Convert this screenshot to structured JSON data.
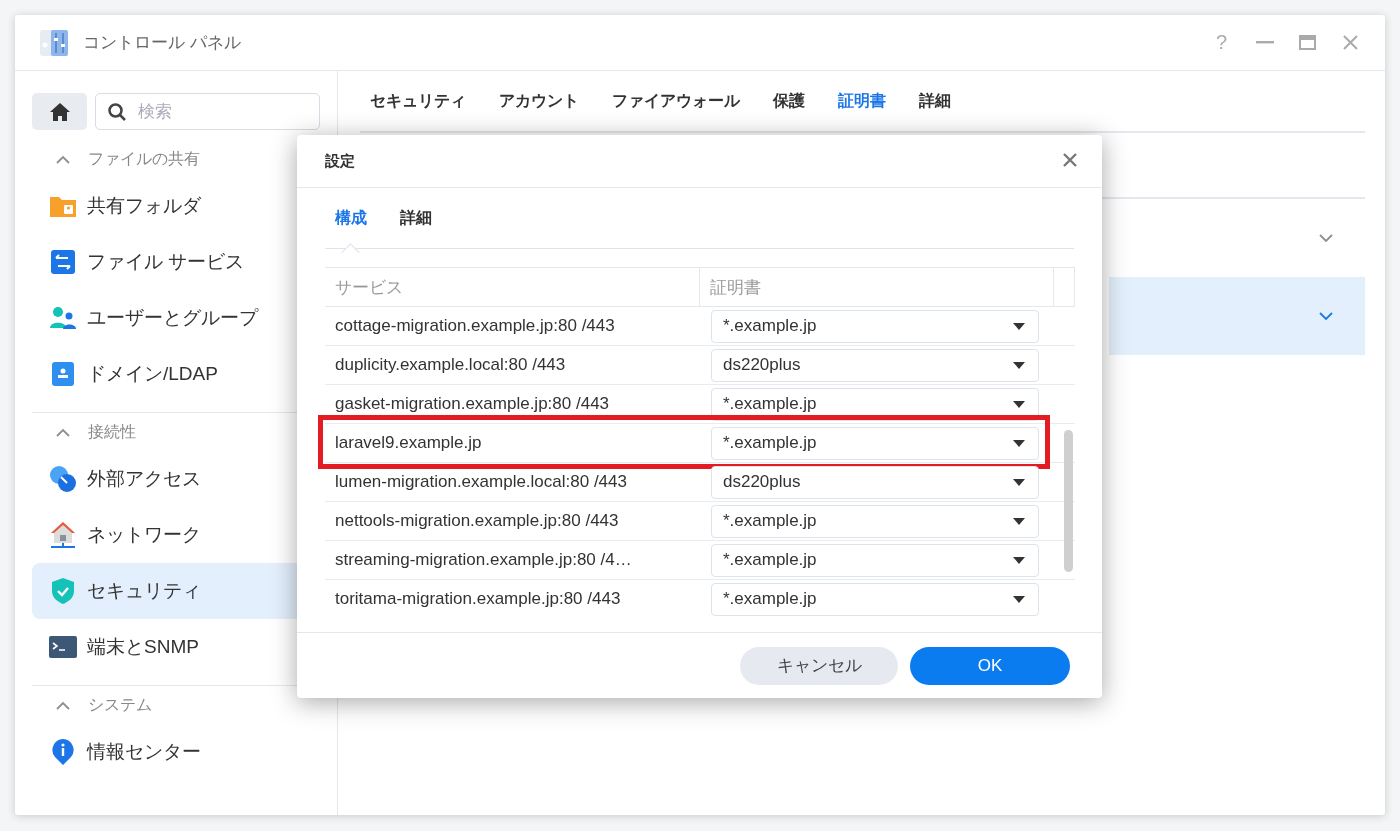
{
  "window": {
    "title": "コントロール パネル",
    "help_label": "?"
  },
  "sidebar": {
    "search": {
      "placeholder": "検索"
    },
    "sections": [
      {
        "title": "ファイルの共有",
        "expanded": true,
        "items": [
          {
            "label": "共有フォルダ",
            "selected": false
          },
          {
            "label": "ファイル サービス",
            "selected": false
          },
          {
            "label": "ユーザーとグループ",
            "selected": false
          },
          {
            "label": "ドメイン/LDAP",
            "selected": false
          }
        ]
      },
      {
        "title": "接続性",
        "expanded": true,
        "items": [
          {
            "label": "外部アクセス",
            "selected": false
          },
          {
            "label": "ネットワーク",
            "selected": false
          },
          {
            "label": "セキュリティ",
            "selected": true
          },
          {
            "label": "端末とSNMP",
            "selected": false
          }
        ]
      },
      {
        "title": "システム",
        "expanded": true,
        "items": [
          {
            "label": "情報センター",
            "selected": false
          }
        ]
      }
    ]
  },
  "main": {
    "tabs": [
      {
        "label": "セキュリティ",
        "selected": false
      },
      {
        "label": "アカウント",
        "selected": false
      },
      {
        "label": "ファイアウォール",
        "selected": false
      },
      {
        "label": "保護",
        "selected": false
      },
      {
        "label": "証明書",
        "selected": true
      },
      {
        "label": "詳細",
        "selected": false
      }
    ],
    "panels": [
      {
        "selected": false
      },
      {
        "selected": true
      }
    ]
  },
  "dialog": {
    "title": "設定",
    "tabs": [
      {
        "label": "構成",
        "selected": true
      },
      {
        "label": "詳細",
        "selected": false
      }
    ],
    "columns": [
      "サービス",
      "証明書"
    ],
    "rows": [
      {
        "service": "cottage-migration.example.jp:80 /443",
        "certificate": "*.example.jp",
        "highlighted": false
      },
      {
        "service": "duplicity.example.local:80 /443",
        "certificate": "ds220plus",
        "highlighted": false
      },
      {
        "service": "gasket-migration.example.jp:80 /443",
        "certificate": "*.example.jp",
        "highlighted": false
      },
      {
        "service": "laravel9.example.jp",
        "certificate": "*.example.jp",
        "highlighted": true
      },
      {
        "service": "lumen-migration.example.local:80 /443",
        "certificate": "ds220plus",
        "highlighted": false
      },
      {
        "service": "nettools-migration.example.jp:80 /443",
        "certificate": "*.example.jp",
        "highlighted": false
      },
      {
        "service": "streaming-migration.example.jp:80 /4…",
        "certificate": "*.example.jp",
        "highlighted": false
      },
      {
        "service": "toritama-migration.example.jp:80 /443",
        "certificate": "*.example.jp",
        "highlighted": false
      }
    ],
    "cancel": "キャンセル",
    "ok": "OK"
  }
}
